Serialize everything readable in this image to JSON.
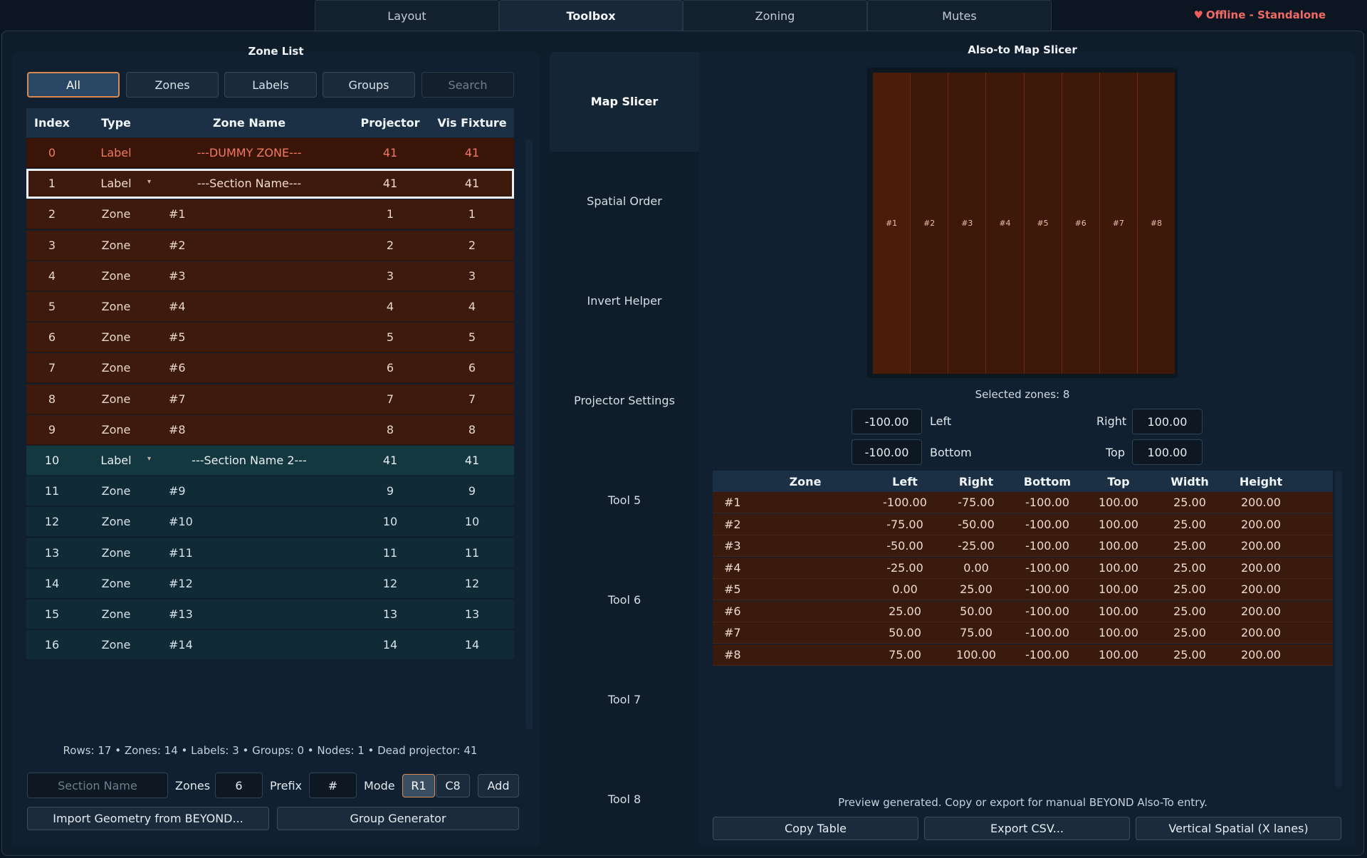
{
  "tabs": [
    {
      "label": "Layout",
      "active": false
    },
    {
      "label": "Toolbox",
      "active": true
    },
    {
      "label": "Zoning",
      "active": false
    },
    {
      "label": "Mutes",
      "active": false
    }
  ],
  "status": {
    "text": "Offline - Standalone",
    "icon": "heart-icon",
    "color": "#f26a63"
  },
  "zone_list": {
    "title": "Zone List",
    "filters": [
      "All",
      "Zones",
      "Labels",
      "Groups"
    ],
    "active_filter": "All",
    "search_placeholder": "Search",
    "columns": [
      "Index",
      "Type",
      "Zone Name",
      "Projector",
      "Vis Fixture"
    ],
    "rows": [
      {
        "index": "0",
        "type": "Label",
        "name": "---DUMMY ZONE---",
        "projector": "41",
        "vis": "41"
      },
      {
        "index": "1",
        "type": "Label",
        "name": "---Section Name---",
        "projector": "41",
        "vis": "41"
      },
      {
        "index": "2",
        "type": "Zone",
        "name": "#1",
        "projector": "1",
        "vis": "1"
      },
      {
        "index": "3",
        "type": "Zone",
        "name": "#2",
        "projector": "2",
        "vis": "2"
      },
      {
        "index": "4",
        "type": "Zone",
        "name": "#3",
        "projector": "3",
        "vis": "3"
      },
      {
        "index": "5",
        "type": "Zone",
        "name": "#4",
        "projector": "4",
        "vis": "4"
      },
      {
        "index": "6",
        "type": "Zone",
        "name": "#5",
        "projector": "5",
        "vis": "5"
      },
      {
        "index": "7",
        "type": "Zone",
        "name": "#6",
        "projector": "6",
        "vis": "6"
      },
      {
        "index": "8",
        "type": "Zone",
        "name": "#7",
        "projector": "7",
        "vis": "7"
      },
      {
        "index": "9",
        "type": "Zone",
        "name": "#8",
        "projector": "8",
        "vis": "8"
      },
      {
        "index": "10",
        "type": "Label",
        "name": "---Section Name 2---",
        "projector": "41",
        "vis": "41"
      },
      {
        "index": "11",
        "type": "Zone",
        "name": "#9",
        "projector": "9",
        "vis": "9"
      },
      {
        "index": "12",
        "type": "Zone",
        "name": "#10",
        "projector": "10",
        "vis": "10"
      },
      {
        "index": "13",
        "type": "Zone",
        "name": "#11",
        "projector": "11",
        "vis": "11"
      },
      {
        "index": "14",
        "type": "Zone",
        "name": "#12",
        "projector": "12",
        "vis": "12"
      },
      {
        "index": "15",
        "type": "Zone",
        "name": "#13",
        "projector": "13",
        "vis": "13"
      },
      {
        "index": "16",
        "type": "Zone",
        "name": "#14",
        "projector": "14",
        "vis": "14"
      }
    ],
    "stats": "Rows: 17 • Zones: 14 • Labels: 3 • Groups: 0 • Nodes: 1 • Dead projector: 41",
    "section_name_placeholder": "Section Name",
    "zones_label": "Zones",
    "zones_value": "6",
    "prefix_label": "Prefix",
    "prefix_value": "#",
    "mode_label": "Mode",
    "mode_options": [
      "R1",
      "C8"
    ],
    "mode_selected": "R1",
    "add_label": "Add",
    "import_label": "Import Geometry from BEYOND...",
    "group_generator_label": "Group Generator"
  },
  "tools": {
    "title": "Also-to Map Slicer",
    "items": [
      "Map Slicer",
      "Spatial Order",
      "Invert Helper",
      "Projector Settings",
      "Tool 5",
      "Tool 6",
      "Tool 7",
      "Tool 8"
    ],
    "active": "Map Slicer"
  },
  "slicer": {
    "slices": [
      "#1",
      "#2",
      "#3",
      "#4",
      "#5",
      "#6",
      "#7",
      "#8"
    ],
    "selected_zones": "Selected zones: 8",
    "left_value": "-100.00",
    "left_label": "Left",
    "right_label": "Right",
    "right_value": "100.00",
    "bottom_value": "-100.00",
    "bottom_label": "Bottom",
    "top_label": "Top",
    "top_value": "100.00",
    "columns": [
      "Zone",
      "Left",
      "Right",
      "Bottom",
      "Top",
      "Width",
      "Height"
    ],
    "rows": [
      [
        "#1",
        "-100.00",
        "-75.00",
        "-100.00",
        "100.00",
        "25.00",
        "200.00"
      ],
      [
        "#2",
        "-75.00",
        "-50.00",
        "-100.00",
        "100.00",
        "25.00",
        "200.00"
      ],
      [
        "#3",
        "-50.00",
        "-25.00",
        "-100.00",
        "100.00",
        "25.00",
        "200.00"
      ],
      [
        "#4",
        "-25.00",
        "0.00",
        "-100.00",
        "100.00",
        "25.00",
        "200.00"
      ],
      [
        "#5",
        "0.00",
        "25.00",
        "-100.00",
        "100.00",
        "25.00",
        "200.00"
      ],
      [
        "#6",
        "25.00",
        "50.00",
        "-100.00",
        "100.00",
        "25.00",
        "200.00"
      ],
      [
        "#7",
        "50.00",
        "75.00",
        "-100.00",
        "100.00",
        "25.00",
        "200.00"
      ],
      [
        "#8",
        "75.00",
        "100.00",
        "-100.00",
        "100.00",
        "25.00",
        "200.00"
      ]
    ],
    "preview_message": "Preview generated. Copy or export for manual BEYOND Also-To entry.",
    "copy_label": "Copy Table",
    "export_label": "Export CSV...",
    "vertical_label": "Vertical Spatial (X lanes)"
  }
}
